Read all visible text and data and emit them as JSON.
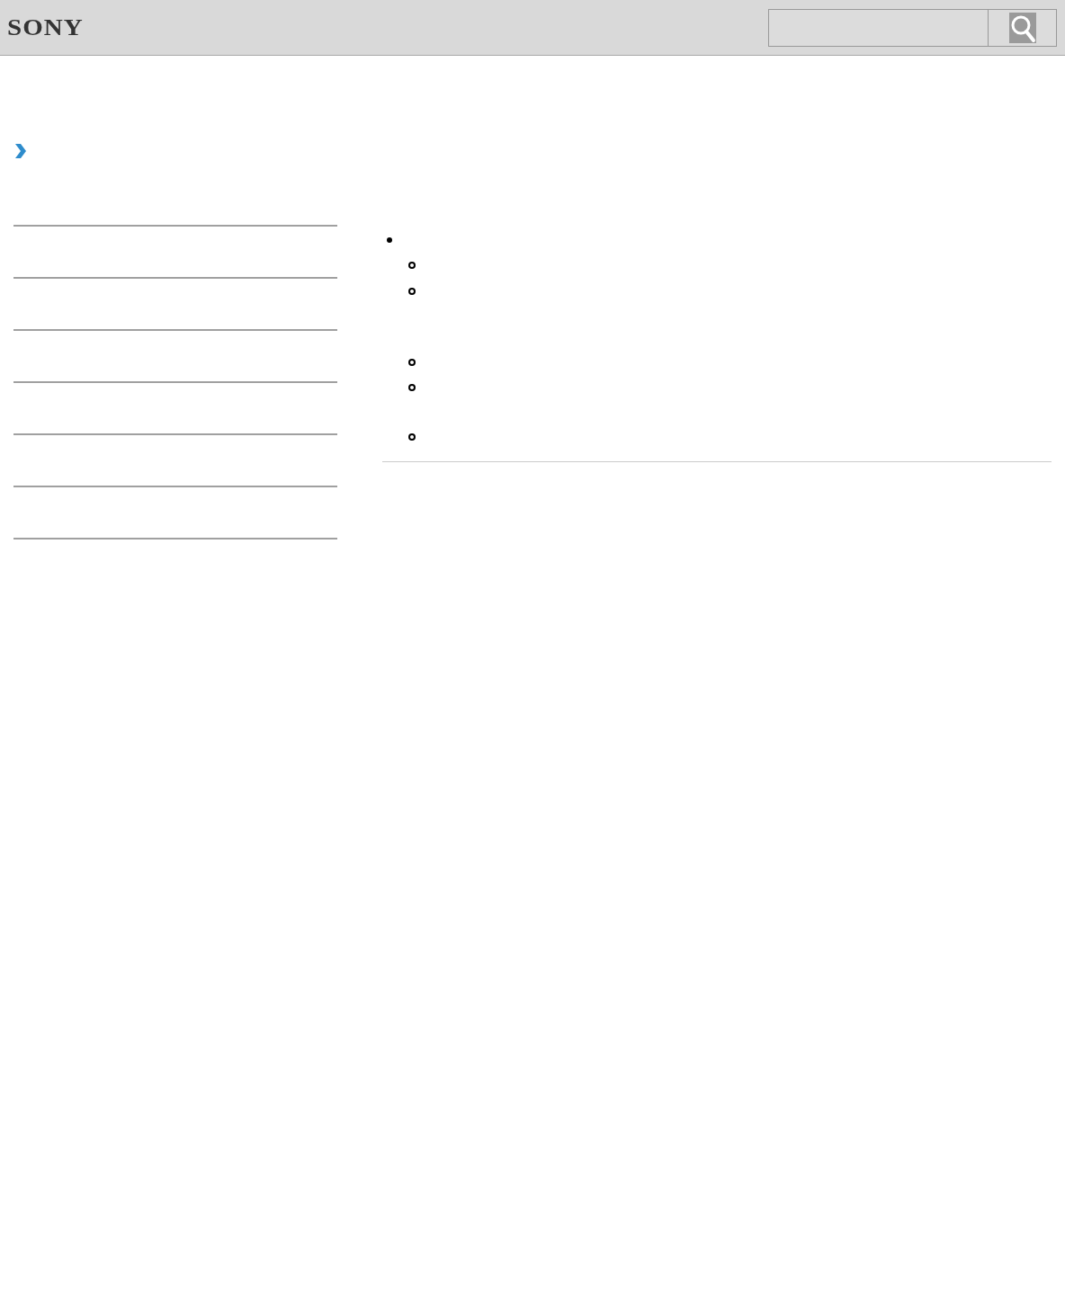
{
  "header": {
    "logo": "SONY"
  },
  "content": {
    "bullets": [
      {
        "kind": "disc",
        "children": [
          {
            "kind": "circle"
          },
          {
            "kind": "circle"
          },
          {
            "kind": "circle"
          },
          {
            "kind": "circle"
          },
          {
            "kind": "circle"
          }
        ]
      }
    ]
  }
}
